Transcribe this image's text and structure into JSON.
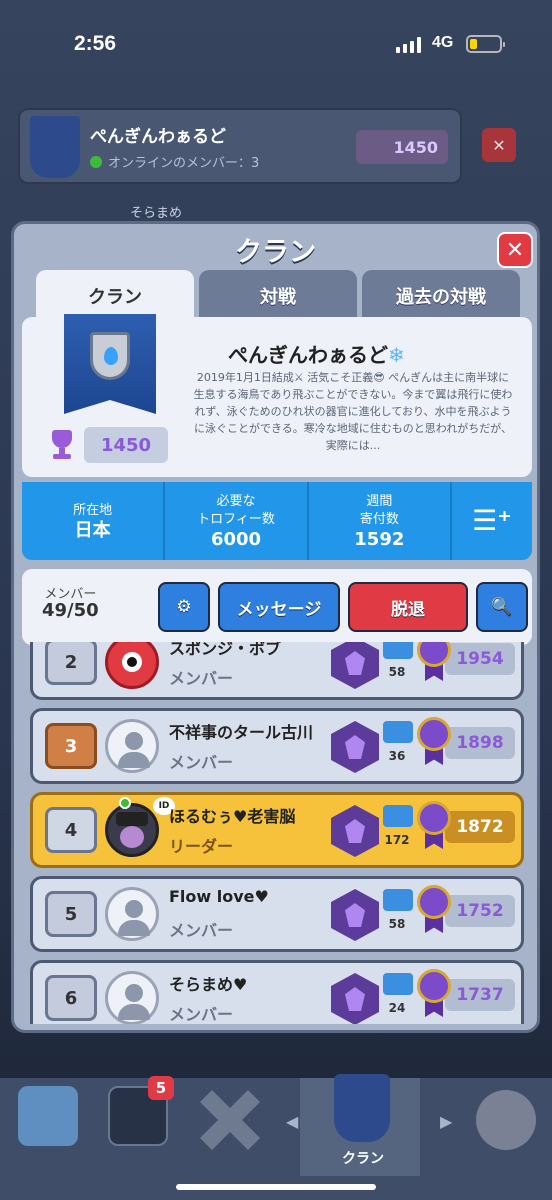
{
  "status": {
    "time": "2:56",
    "network": "4G"
  },
  "background": {
    "clan_name": "ぺんぎんわぁるど",
    "online_label": "オンラインのメンバー：3",
    "trophies": "1450",
    "chat_name": "そらまめ"
  },
  "modal": {
    "title": "クラン",
    "tabs": [
      "クラン",
      "対戦",
      "過去の対戦"
    ],
    "clan": {
      "name": "ぺんぎんわぁるど",
      "description": "2019年1月1日結成⚔ 活気こそ正義😎 ぺんぎんは主に南半球に生息する海鳥であり飛ぶことができない。今まで翼は飛行に使われず、泳ぐためのひれ状の器官に進化しており、水中を飛ぶように泳ぐことができる。寒冷な地域に住むものと思われがちだが、実際には...",
      "trophies": "1450"
    },
    "stats": [
      {
        "label": "所在地",
        "value": "日本"
      },
      {
        "label": "必要な\nトロフィー数",
        "value": "6000"
      },
      {
        "label": "週間\n寄付数",
        "value": "1592"
      }
    ],
    "members_label": "メンバー",
    "members_count": "49/50",
    "buttons": {
      "message": "メッセージ",
      "leave": "脱退"
    },
    "members": [
      {
        "rank": "2",
        "name": "スポンジ・ボブ",
        "role": "メンバー",
        "donations": "58",
        "trophies": "1954",
        "online": true,
        "avatar": "eye"
      },
      {
        "rank": "3",
        "name": "不祥事のタール古川",
        "role": "メンバー",
        "donations": "36",
        "trophies": "1898",
        "online": false,
        "avatar": "blank"
      },
      {
        "rank": "4",
        "name": "ほるむぅ♥老害脳",
        "role": "リーダー",
        "donations": "172",
        "trophies": "1872",
        "online": true,
        "avatar": "char"
      },
      {
        "rank": "5",
        "name": "Flow love♥",
        "role": "メンバー",
        "donations": "58",
        "trophies": "1752",
        "online": false,
        "avatar": "blank"
      },
      {
        "rank": "6",
        "name": "そらまめ♥",
        "role": "メンバー",
        "donations": "24",
        "trophies": "1737",
        "online": false,
        "avatar": "blank"
      }
    ]
  },
  "nav": {
    "cards_badge": "5",
    "active_label": "クラン"
  }
}
